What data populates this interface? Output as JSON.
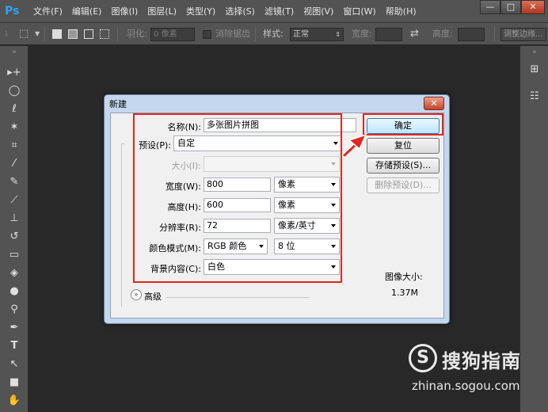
{
  "app": {
    "logo": "Ps"
  },
  "menu": [
    "文件(F)",
    "编辑(E)",
    "图像(I)",
    "图层(L)",
    "类型(Y)",
    "选择(S)",
    "滤镜(T)",
    "视图(V)",
    "窗口(W)",
    "帮助(H)"
  ],
  "window_controls": {
    "minimize": "—",
    "restore": "□",
    "close": "✕"
  },
  "options": {
    "feather_label": "羽化:",
    "feather_value": "0 像素",
    "antialias_label": "消除锯齿",
    "style_label": "样式:",
    "style_value": "正常",
    "width_label": "宽度:",
    "height_label": "高度:",
    "refine_edge": "调整边缘..."
  },
  "dialog": {
    "title": "新建",
    "close": "✕",
    "name_label": "名称(N):",
    "name_value": "多张图片拼图",
    "preset_label": "预设(P):",
    "preset_value": "自定",
    "size_label": "大小(I):",
    "width_label": "宽度(W):",
    "width_value": "800",
    "width_unit": "像素",
    "height_label": "高度(H):",
    "height_value": "600",
    "height_unit": "像素",
    "resolution_label": "分辨率(R):",
    "resolution_value": "72",
    "resolution_unit": "像素/英寸",
    "color_mode_label": "颜色模式(M):",
    "color_mode_value": "RGB 颜色",
    "bit_depth_value": "8 位",
    "background_label": "背景内容(C):",
    "background_value": "白色",
    "advanced_label": "高级",
    "image_size_label": "图像大小:",
    "image_size_value": "1.37M",
    "ok_button": "确定",
    "reset_button": "复位",
    "save_preset_button": "存储预设(S)...",
    "delete_preset_button": "删除预设(D)..."
  },
  "watermark": {
    "logo_glyph": "S",
    "title": "搜狗指南",
    "url": "zhinan.sogou.com"
  },
  "colors": {
    "highlight": "#e2261f",
    "ps_blue": "#2fa3f0"
  }
}
